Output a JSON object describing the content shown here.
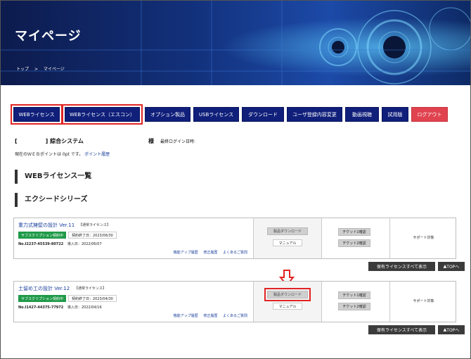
{
  "header": {
    "title": "マイページ",
    "breadcrumb": [
      "トップ",
      ">",
      "マイページ"
    ]
  },
  "nav": [
    {
      "label": "WEBライセンス"
    },
    {
      "label": "WEBライセンス（エスコン）"
    },
    {
      "label": "オプション製品"
    },
    {
      "label": "USBライセンス"
    },
    {
      "label": "ダウンロード"
    },
    {
      "label": "ユーザ登録内容変更"
    },
    {
      "label": "動画視聴"
    },
    {
      "label": "試用版"
    },
    {
      "label": "ログアウト"
    }
  ],
  "account": {
    "system_name": "[　　　　　] 綜合システム",
    "honorific": "様",
    "last_login_label": "最終ログイン日時:",
    "points_text": "現在のＷＥＢポイントは 0pt です。",
    "points_link": "ポイント履歴"
  },
  "sections": {
    "web_license_title": "WEBライセンス一覧",
    "series_title": "エクシードシリーズ"
  },
  "licenses": [
    {
      "product": "重力式擁壁の設計 Ver.11",
      "license_type": "【通常ライセンス】",
      "status": "サブスクリプション契約中",
      "expiry": "契約終了日：2023/06/30",
      "number_label": "No.",
      "number": "I2237-45539-80722",
      "install_date": "導入日：2022/06/07",
      "links": [
        "機能アップ履歴",
        "修正履歴",
        "よくあるご質問"
      ],
      "download_label": "製品ダウンロード",
      "manual_label": "マニュアル",
      "ticket1": "チケット1確認",
      "ticket2": "チケット2確認",
      "support": "サポート対象"
    },
    {
      "product": "土留め工の設計 Ver.12",
      "license_type": "【通常ライセンス】",
      "status": "サブスクリプション契約中",
      "expiry": "契約終了日：2023/04/30",
      "number_label": "No.",
      "number": "I1427-44375-77972",
      "install_date": "導入日：2022/04/16",
      "links": [
        "機能アップ履歴",
        "修正履歴",
        "よくあるご質問"
      ],
      "download_label": "製品ダウンロード",
      "manual_label": "マニュアル",
      "ticket1": "チケット1確認",
      "ticket2": "チケット2確認",
      "support": "サポート対象"
    }
  ],
  "actions": {
    "show_all": "保有ライセンスすべて表示",
    "to_top": "TOPへ"
  },
  "icons": {
    "arrow": "down-arrow-icon",
    "to_top": "up-arrow-icon"
  },
  "colors": {
    "nav": "#0f1f7a",
    "logout": "#e0434f",
    "status": "#1f9a48",
    "highlight": "#e02424"
  }
}
